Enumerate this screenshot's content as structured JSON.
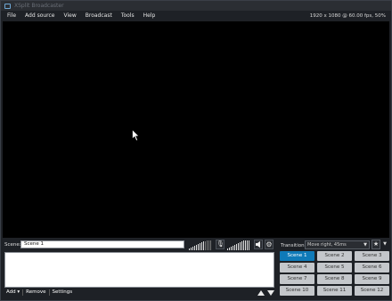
{
  "window": {
    "title": "XSplit Broadcaster"
  },
  "menu": {
    "items": [
      "File",
      "Add source",
      "View",
      "Broadcast",
      "Tools",
      "Help"
    ],
    "resolution_info": "1920 x 1080 @ 60.00 fps, 50%"
  },
  "scene_bar": {
    "label": "Scene:",
    "scene_name": "Scene 1"
  },
  "source_actions": {
    "add": "Add ▾",
    "remove": "Remove",
    "settings": "Settings"
  },
  "transition": {
    "label": "Transition:",
    "selected": "Move right, 45ms"
  },
  "scenes": [
    {
      "label": "Scene 1",
      "active": true
    },
    {
      "label": "Scene 2",
      "active": false
    },
    {
      "label": "Scene 3",
      "active": false
    },
    {
      "label": "Scene 4",
      "active": false
    },
    {
      "label": "Scene 5",
      "active": false
    },
    {
      "label": "Scene 6",
      "active": false
    },
    {
      "label": "Scene 7",
      "active": false
    },
    {
      "label": "Scene 8",
      "active": false
    },
    {
      "label": "Scene 9",
      "active": false
    },
    {
      "label": "Scene 10",
      "active": false
    },
    {
      "label": "Scene 11",
      "active": false
    },
    {
      "label": "Scene 12",
      "active": false
    }
  ],
  "icons": {
    "app": "xsplit-logo-icon",
    "mic": "mic-muted-icon",
    "speaker": "speaker-icon",
    "settings": "gear-icon",
    "favorite": "star-icon",
    "move_up": "arrow-up-icon",
    "move_down": "arrow-down-icon"
  },
  "colors": {
    "active_scene": "#0f7ab8",
    "inactive_scene": "#c4c7cb",
    "background": "#1e2126",
    "preview": "#000000"
  }
}
